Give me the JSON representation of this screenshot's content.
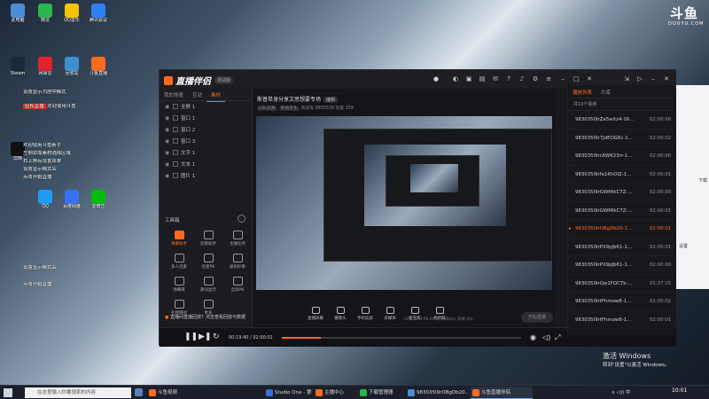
{
  "desktop": {
    "icons": [
      {
        "label": "此电脑",
        "color": "#4a8fd6"
      },
      {
        "label": "微信",
        "color": "#2bb54a"
      },
      {
        "label": "QQ音乐",
        "color": "#f5c400"
      },
      {
        "label": "腾讯会议",
        "color": "#2f7ff0"
      },
      {
        "label": "Steam",
        "color": "#1b2838"
      },
      {
        "label": "网易云",
        "color": "#e0232b"
      },
      {
        "label": "回收站",
        "color": "#3d8fcf"
      },
      {
        "label": "斗鱼直播",
        "color": "#ff6a1f"
      },
      {
        "label": "剪映",
        "color": "#111111"
      },
      {
        "label": "QQ",
        "color": "#1d9bf0"
      },
      {
        "label": "百度网盘",
        "color": "#3574f0"
      },
      {
        "label": "爱奇艺",
        "color": "#00be06"
      }
    ],
    "notes": {
      "line1": "设置显示为居中模式",
      "line2_hl": "轻松直播",
      "line2": "欢迎使用斗鱼",
      "line3": "欢迎使用斗鱼新手",
      "line4": "左侧添加素材选择区域",
      "line5": "右上角有设置菜单",
      "line6": "设置显示模式后",
      "line7": "点击开始直播",
      "line8": "设置显示模式后",
      "line9": "点击开始直播"
    }
  },
  "watermark": {
    "big": "斗鱼",
    "small": "DOUYU.COM"
  },
  "activation": {
    "title": "激活 Windows",
    "sub": "转到\"设置\"以激活 Windows。"
  },
  "right_panel": {
    "text1": "下载",
    "text2": "设置"
  },
  "app": {
    "logo": "直播伴侣",
    "beta": "测试版",
    "left_tabs": [
      "我的场景",
      "互动",
      "素材"
    ],
    "left_tab_active": 2,
    "scenes": [
      "全屏 1",
      "窗口 1",
      "窗口 2",
      "窗口 3",
      "文字 1",
      "文本 1",
      "图片 1"
    ],
    "tools_title": "工具箱",
    "tools": [
      {
        "label": "弹幕助手",
        "hot": true
      },
      {
        "label": "房管助手",
        "hot": false
      },
      {
        "label": "主播任务",
        "hot": false
      },
      {
        "label": "多人连麦",
        "hot": false
      },
      {
        "label": "连麦PK",
        "hot": false
      },
      {
        "label": "虚拟形象",
        "hot": false
      },
      {
        "label": "弹幕库",
        "hot": false
      },
      {
        "label": "歌词显示",
        "hot": false
      },
      {
        "label": "全屏PK",
        "hot": false
      },
      {
        "label": "礼物特效",
        "hot": false
      },
      {
        "label": "更多",
        "hot": false
      }
    ],
    "stream_title": "斯普单身分享文思想要专场",
    "edit_label": "编辑",
    "sub_tags": [
      "LOL竞赛",
      "绝地求生"
    ],
    "sub_text": "房间号 9835539  热度 159",
    "controls": [
      {
        "label": "直播屏幕"
      },
      {
        "label": "摄像头"
      },
      {
        "label": "手机投屏"
      },
      {
        "label": "多媒体"
      },
      {
        "label": "麦克风"
      },
      {
        "label": "扬声器"
      }
    ],
    "go_live": "开始直播",
    "stats": "CPU 0%   FPS 60   码率 0kb/s   丢帧 0%",
    "notice_dot": "●",
    "notice": "直播间直播回放？点击查看回放与数据",
    "player": {
      "elapsed": "00:19:40",
      "total": "02:00:01",
      "progress": 0.164
    }
  },
  "sidebar": {
    "tabs": [
      "播放列表",
      "片库"
    ],
    "active_tab": 0,
    "header": "共10个视频",
    "items": [
      {
        "name": "983035l9rZa5witz4-16...",
        "dur": "02:00:00",
        "active": false
      },
      {
        "name": "983035l9r7JdEOGEc-1...",
        "dur": "02:00:02",
        "active": false
      },
      {
        "name": "983035l9rc6WK23rr-1...",
        "dur": "02:00:00",
        "active": false
      },
      {
        "name": "983035l9rfa1KhOIZ-1...",
        "dur": "02:00:01",
        "active": false
      },
      {
        "name": "983035l9rGWMlkC7Z-...",
        "dur": "02:00:00",
        "active": false
      },
      {
        "name": "983035l9rGWMlkC7Z-...",
        "dur": "02:00:01",
        "active": false
      },
      {
        "name": "983035l9rOBgDb20-1...",
        "dur": "02:00:01",
        "active": true
      },
      {
        "name": "983035l9rPX9pJb61-1...",
        "dur": "02:00:01",
        "active": false
      },
      {
        "name": "983035l9rPX9pJb61-1...",
        "dur": "02:00:00",
        "active": false
      },
      {
        "name": "983035l9rQw1FQCTk-...",
        "dur": "01:37:15",
        "active": false
      },
      {
        "name": "983035l9rtFhmow8-1...",
        "dur": "02:00:02",
        "active": false
      },
      {
        "name": "983035l9rtFhmow8-1...",
        "dur": "02:00:01",
        "active": false
      }
    ]
  },
  "taskbar": {
    "search": "在这里输入你要搜索的内容",
    "tasks": [
      {
        "label": "斗鱼视频",
        "color": "#ff6a1f",
        "active": false
      },
      {
        "label": "Studio One - 第8期...",
        "color": "#3a6ed8",
        "active": false
      },
      {
        "label": "主播中心",
        "color": "#ff6a1f",
        "active": false
      },
      {
        "label": "下载管理器",
        "color": "#2bb54a",
        "active": false
      },
      {
        "label": "983035l9rOBgDb20...",
        "color": "#4a8fd6",
        "active": false
      },
      {
        "label": "斗鱼直播伴侣",
        "color": "#ff6a1f",
        "active": true
      }
    ],
    "tray": "∧ ◁)) 中",
    "clock": "10:01"
  }
}
